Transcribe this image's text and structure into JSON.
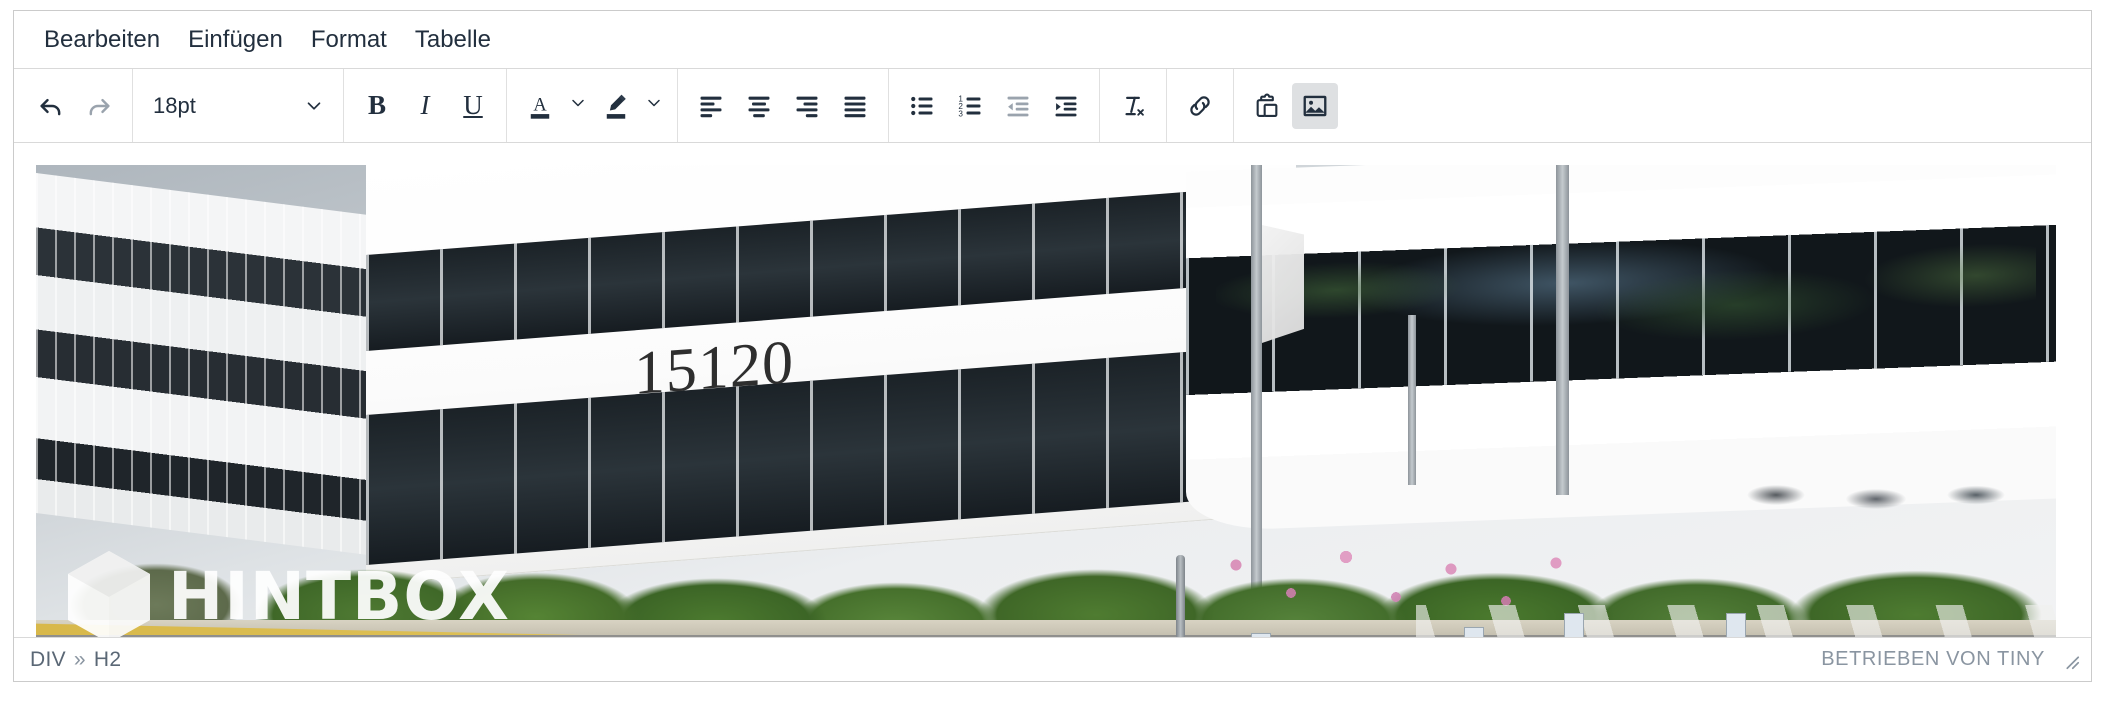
{
  "menubar": {
    "items": [
      {
        "label": "Bearbeiten",
        "name": "menu-edit"
      },
      {
        "label": "Einfügen",
        "name": "menu-insert"
      },
      {
        "label": "Format",
        "name": "menu-format"
      },
      {
        "label": "Tabelle",
        "name": "menu-table"
      }
    ]
  },
  "toolbar": {
    "undo_label": "undo-icon",
    "redo_label": "redo-icon",
    "fontsize_value": "18pt",
    "bold_label": "B",
    "italic_label": "I",
    "underline_label": "U",
    "textcolor_label": "A",
    "buttons": [
      "undo",
      "redo",
      "fontsize",
      "bold",
      "italic",
      "underline",
      "text-color",
      "background-color",
      "align-left",
      "align-center",
      "align-right",
      "align-justify",
      "bullet-list",
      "numbered-list",
      "decrease-indent",
      "increase-indent",
      "remove-format",
      "link",
      "paste",
      "image"
    ],
    "active_button": "image",
    "disabled_buttons": [
      "redo",
      "decrease-indent"
    ]
  },
  "content": {
    "image": {
      "alt": "office-building-photo",
      "building_number": "15120",
      "watermark_text": "HINTBOX"
    }
  },
  "statusbar": {
    "path": [
      "DIV",
      "H2"
    ],
    "separator": "»",
    "branding": "BETRIEBEN VON TINY",
    "resize_handle": "resize-handle-icon"
  },
  "colors": {
    "toolbar_icon": "#222f3e",
    "disabled_icon": "#9aa3ad",
    "active_button_bg": "#dee0e2",
    "border": "#cbcbcb",
    "status_text": "#5a6775",
    "branding_text": "#8a95a1"
  }
}
